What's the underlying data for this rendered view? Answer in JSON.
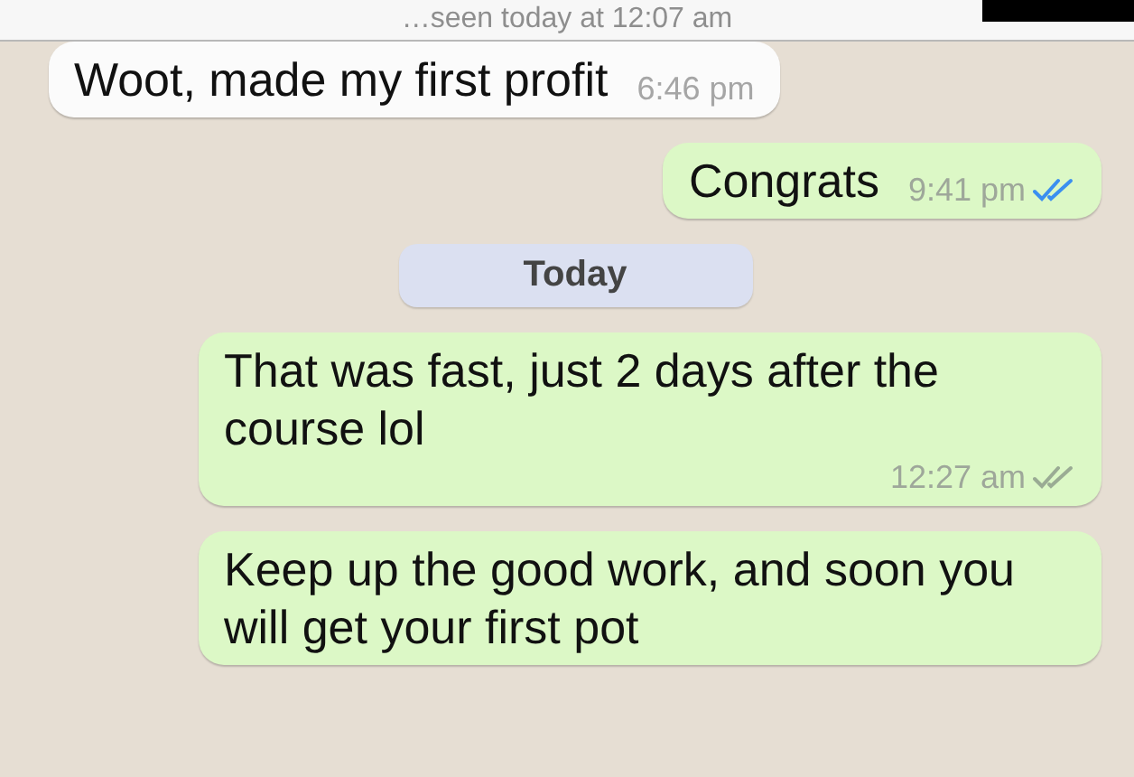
{
  "header": {
    "status": "…seen today at 12:07 am"
  },
  "messages": [
    {
      "kind": "incoming",
      "text": "Woot, made my first profit",
      "time": "6:46 pm"
    },
    {
      "kind": "outgoing",
      "text": "Congrats",
      "time": "9:41 pm",
      "read": true
    },
    {
      "kind": "date",
      "text": "Today"
    },
    {
      "kind": "outgoing",
      "text": "That was fast, just 2 days after the course lol",
      "time": "12:27 am",
      "read": false
    },
    {
      "kind": "outgoing",
      "text": "Keep up the good work, and soon you will get your first pot"
    }
  ]
}
